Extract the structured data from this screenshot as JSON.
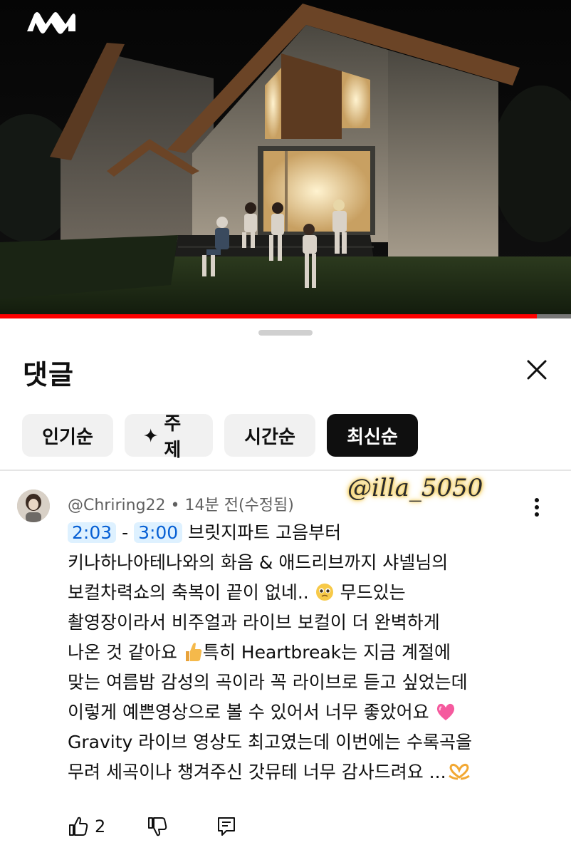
{
  "video": {
    "logo_icon": "wavy-m-logo-icon",
    "progress_fraction": 0.94,
    "progress_color": "#ff0000"
  },
  "comments_panel": {
    "title": "댓글",
    "close_icon": "close-x-icon",
    "sort_chips": [
      {
        "label": "인기순",
        "active": false
      },
      {
        "label": "주제",
        "icon": "sparkle-icon",
        "active": false
      },
      {
        "label": "시간순",
        "active": false
      },
      {
        "label": "최신순",
        "active": true
      }
    ]
  },
  "watermark": "@illa_5050",
  "comment": {
    "author": "@Chriring22",
    "separator": " • ",
    "time": "14분 전(수정됨)",
    "timestamp_1": "2:03",
    "dash": " - ",
    "timestamp_2": "3:00",
    "line_1": "브릿지파트 고음부터",
    "line_2": "키나하나아테나와의 화음 & 애드리브까지 샤넬님의",
    "line_3a": "보컬차력쇼의 축복이 끝이 없네..",
    "line_3b": "무드있는",
    "line_4": "촬영장이라서 비주얼과 라이브 보컬이 더 완벽하게",
    "line_5a": "나온 것 같아요",
    "line_5b": "특히 Heartbreak는 지금 계절에",
    "line_6": "맞는 여름밤 감성의 곡이라 꼭 라이브로 듣고 싶었는데",
    "line_7": "이렇게 예쁜영상으로 볼 수 있어서 너무 좋았어요",
    "line_8": "Gravity 라이브 영상도 최고였는데 이번에는 수록곡을",
    "line_9": "무려 세곡이나 챙겨주신 갓뮤테 너무 감사드려요 ...",
    "emoji_icons": [
      "pleading-face-icon",
      "thumbs-up-icon",
      "pink-heart-icon",
      "heart-hands-icon"
    ],
    "like_count": "2",
    "actions": [
      "like-icon",
      "dislike-icon",
      "reply-icon"
    ]
  },
  "colors": {
    "timestamp_link": "#065fd4",
    "active_chip": "#0f0f0f"
  }
}
